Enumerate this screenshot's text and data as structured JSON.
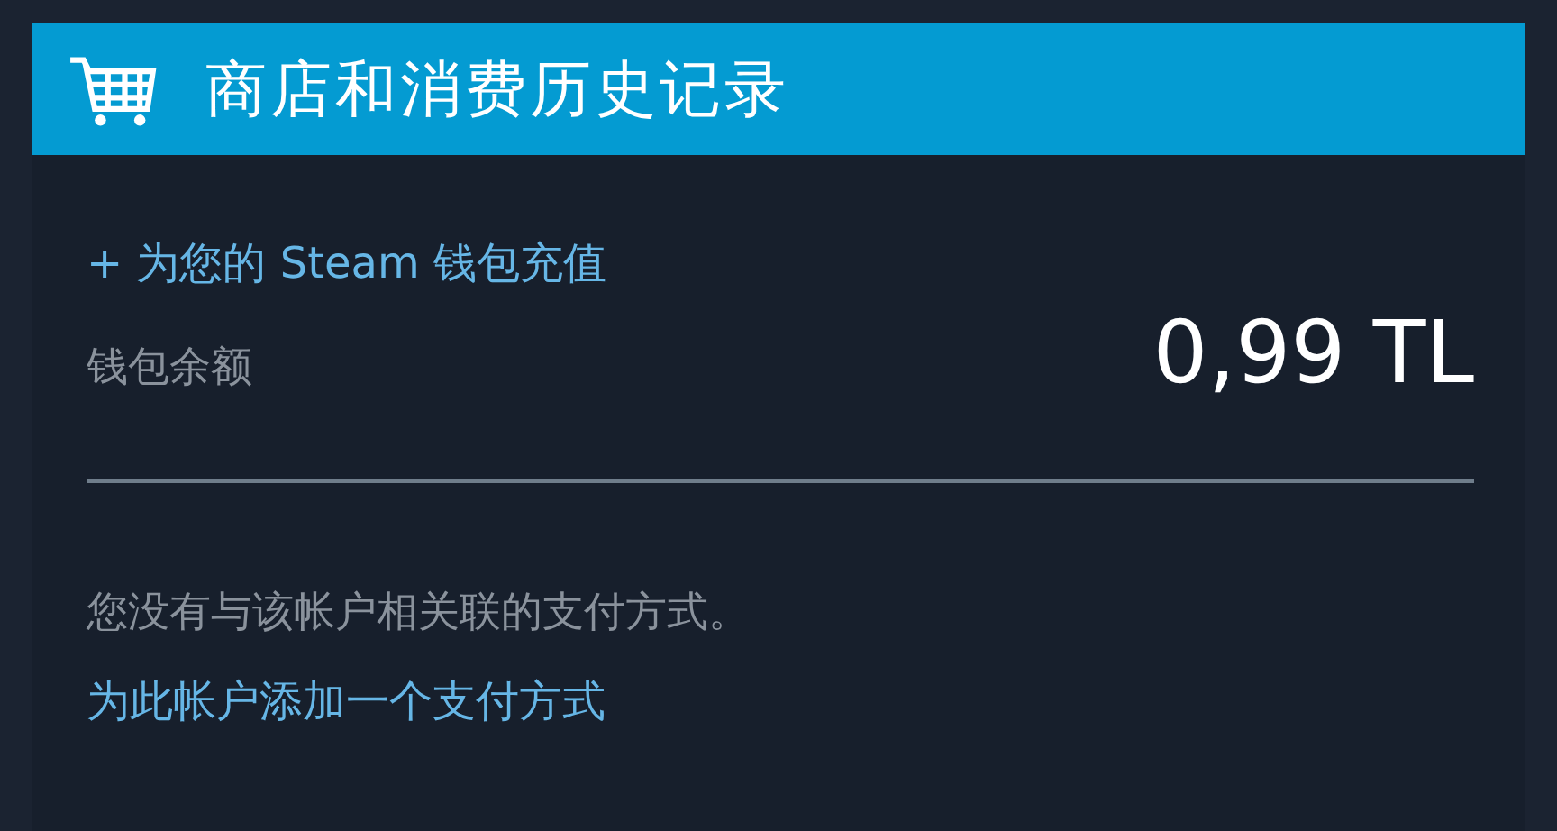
{
  "header": {
    "title": "商店和消费历史记录"
  },
  "wallet": {
    "add_funds_link": "+ 为您的 Steam 钱包充值",
    "balance_label": "钱包余额",
    "balance": "0,99 TL"
  },
  "payment": {
    "message": "您没有与该帐户相关联的支付方式。",
    "add_link": "为此帐户添加一个支付方式"
  }
}
